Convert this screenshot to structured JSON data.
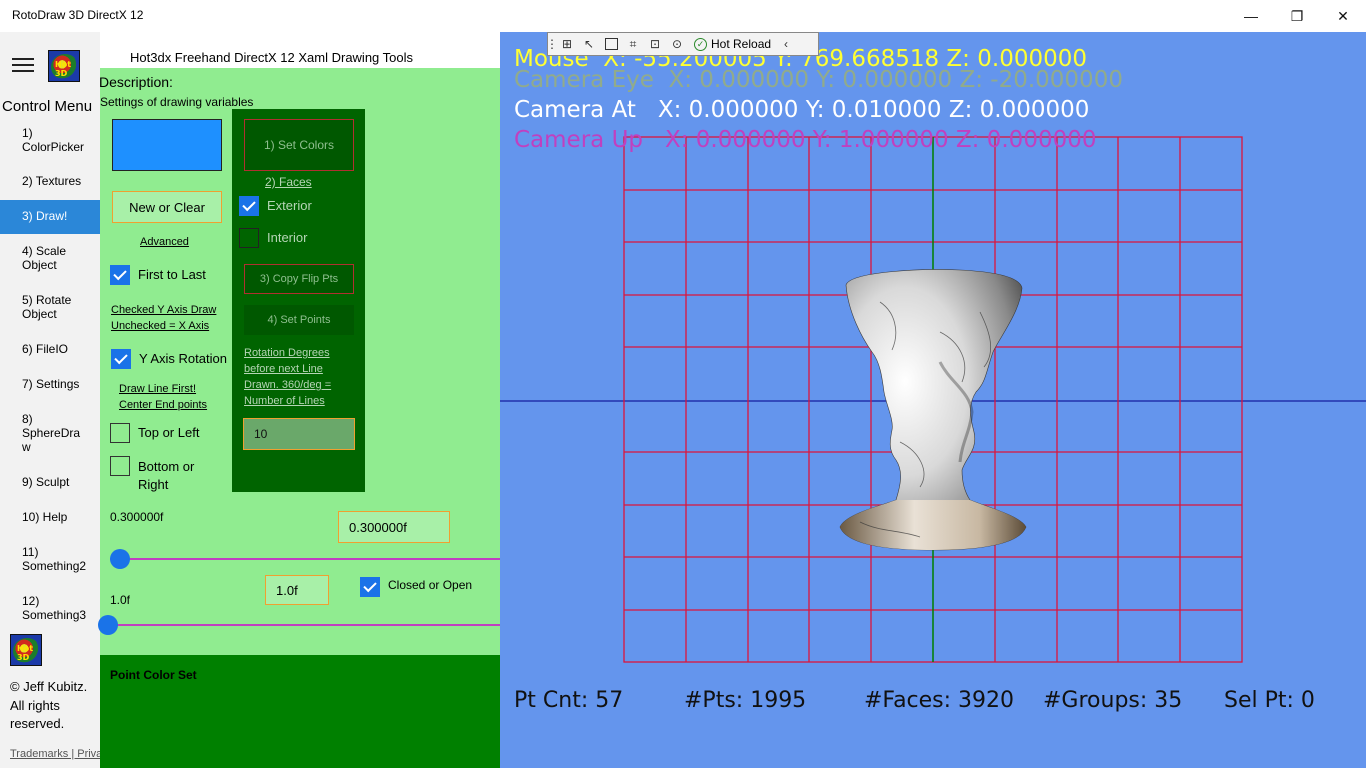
{
  "window": {
    "title": "RotoDraw 3D DirectX 12",
    "minimize": "—",
    "restore": "❐",
    "close": "✕"
  },
  "nav": {
    "title": "Control Menu",
    "logo_text": "Hot 3D",
    "items": [
      {
        "label": "1)\nColorPicker"
      },
      {
        "label": "2) Textures"
      },
      {
        "label": "3) Draw!"
      },
      {
        "label": "4) Scale\nObject"
      },
      {
        "label": "5) Rotate\nObject"
      },
      {
        "label": "6) FileIO"
      },
      {
        "label": "7) Settings"
      },
      {
        "label": "8)\nSphereDra\nw"
      },
      {
        "label": "9) Sculpt"
      },
      {
        "label": "10) Help"
      },
      {
        "label": "11)\nSomething2"
      },
      {
        "label": "12)\nSomething3"
      }
    ],
    "selected_index": 2,
    "copyright": "© Jeff Kubitz. All rights reserved.",
    "trademarks": "Trademarks | Privacy"
  },
  "panel": {
    "heading": "Hot3dx Freehand DirectX 12 Xaml Drawing Tools",
    "description_title": "Description:",
    "description_sub": "Settings of drawing variables",
    "swatch_color": "#1e90ff",
    "new_or_clear": "New or Clear",
    "advanced": "Advanced",
    "first_to_last": {
      "label": "First to Last",
      "checked": true
    },
    "axis_note_1": "Checked Y Axis Draw",
    "axis_note_2": "Unchecked = X Axis",
    "y_axis_rotation": {
      "label": "Y Axis Rotation",
      "checked": true
    },
    "draw_line_note_1": "Draw Line First!",
    "draw_line_note_2": "Center End points",
    "top_or_left": {
      "label": "Top or Left",
      "checked": false
    },
    "bottom_or_right": {
      "label": "Bottom or\nRight",
      "checked": false
    },
    "slider1": {
      "label": "0.300000f",
      "value_box": "0.300000f",
      "fraction": 0.05
    },
    "slider2": {
      "label": "1.0f",
      "value_box": "1.0f",
      "fraction": 0.02
    },
    "closed_or_open": {
      "label": "Closed or Open",
      "checked": true
    },
    "point_color_set": "Point Color Set"
  },
  "dark_panel": {
    "set_colors": "1) Set Colors",
    "faces": "2) Faces",
    "exterior": {
      "label": "Exterior",
      "checked": true
    },
    "interior": {
      "label": "Interior",
      "checked": false
    },
    "copy_flip": "3) Copy Flip Pts",
    "set_points": "4) Set Points",
    "rotation_note": "Rotation Degrees before next Line Drawn. 360/deg = Number of Lines",
    "rotation_value": "10"
  },
  "debug_toolbar": {
    "hot_reload": "Hot Reload"
  },
  "viewport": {
    "mouse": "Mouse  X: -55.200005 Y: 769.668518 Z: 0.000000",
    "camera_eye": "Camera Eye  X: 0.000000 Y: 0.000000 Z: -20.000000",
    "camera_at": "Camera At   X: 0.000000 Y: 0.010000 Z: 0.000000",
    "camera_up": "Camera Up   X: 0.000000 Y: 1.000000 Z: 0.000000",
    "colors": {
      "mouse": "#ffff33",
      "camera_eye": "#9ab07a",
      "camera_at": "#ffffff",
      "camera_up": "#c040c0",
      "grid": "#dc143c",
      "y_axis": "#008000",
      "x_axis": "#00008b",
      "background": "#6495ed"
    },
    "pt_cnt": "Pt Cnt: 57",
    "num_pts": "#Pts: 1995",
    "num_faces": "#Faces: 3920",
    "num_groups": "#Groups: 35",
    "sel_pt": "Sel Pt: 0"
  }
}
